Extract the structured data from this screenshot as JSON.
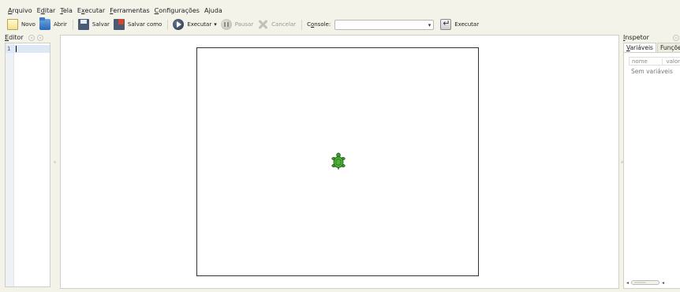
{
  "menu": {
    "items": [
      {
        "label": "Arquivo",
        "mn": "A",
        "rest": "rquivo"
      },
      {
        "label": "Editar",
        "mn": "E",
        "rest": "ditar",
        "pre": ""
      },
      {
        "label": "Tela",
        "mn": "T",
        "rest": "ela"
      },
      {
        "label": "Executar",
        "pre": "E",
        "mn": "x",
        "rest": "ecutar"
      },
      {
        "label": "Ferramentas",
        "mn": "F",
        "rest": "erramentas"
      },
      {
        "label": "Configurações",
        "mn": "C",
        "rest": "onfigurações"
      },
      {
        "label": "Ajuda",
        "mn": "",
        "rest": "Ajuda"
      }
    ]
  },
  "toolbar": {
    "new_label": "Novo",
    "open_label": "Abrir",
    "save_label": "Salvar",
    "saveas_label": "Salvar como",
    "run_label": "Executar",
    "pause_label": "Pausar",
    "cancel_label": "Cancelar",
    "console_label_pre": "C",
    "console_label_mn": "o",
    "console_label_rest": "nsole:",
    "console_value": "",
    "execute_label": "Executar"
  },
  "editor": {
    "title_mn": "E",
    "title_rest": "ditor",
    "line_number": "1",
    "code": ""
  },
  "inspector": {
    "title_mn": "I",
    "title_rest": "nspetor",
    "tab_variables_mn": "V",
    "tab_variables_rest": "ariáveis",
    "tab_functions": "Funções",
    "col_name": "nome",
    "col_value": "valor",
    "empty_text": "Sem variáveis"
  },
  "colors": {
    "window_bg": "#f3f3ea",
    "turtle_green": "#3f9a2e"
  },
  "icons": [
    "new-file-icon",
    "open-folder-icon",
    "floppy-disk-icon",
    "save-as-icon",
    "play-icon",
    "pause-icon",
    "cancel-icon",
    "enter-icon",
    "turtle-icon"
  ]
}
